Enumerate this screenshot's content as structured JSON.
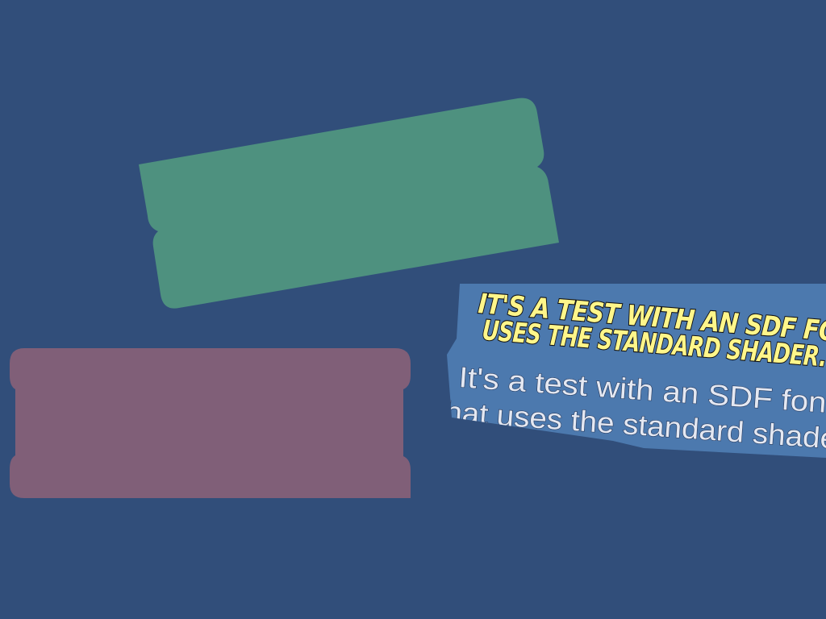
{
  "colors": {
    "background": "#314e7a",
    "green_panel": "#4e917f",
    "purple_panel": "#805f78",
    "blue_panel": "#4c79ae",
    "comic_text_fill": "#fff68a",
    "comic_text_outline": "#111111",
    "plain_text": "#e4e8f2"
  },
  "text_panel": {
    "comic_lines": [
      "It's a test with an SDF font that",
      "uses the standard shader."
    ],
    "plain_lines": [
      "It's a test with an SDF font",
      "that uses the standard shader."
    ]
  }
}
